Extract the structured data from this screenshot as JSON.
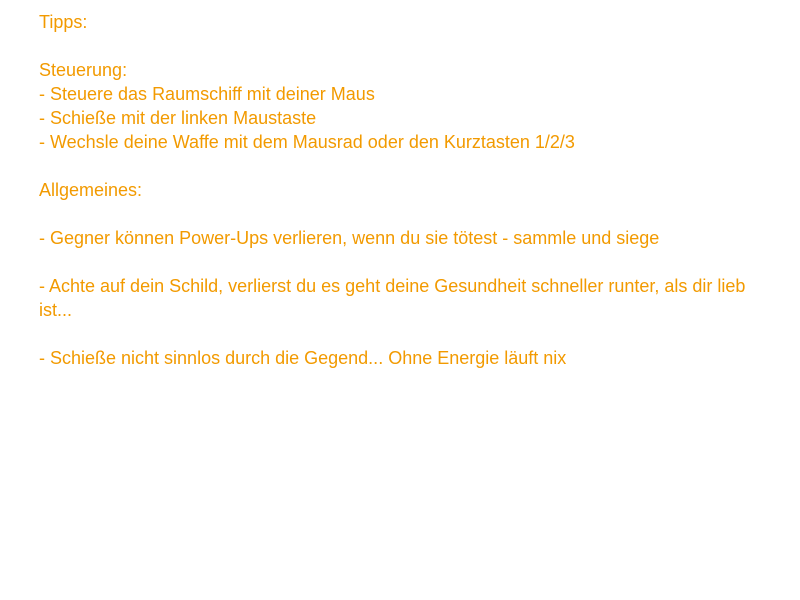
{
  "colors": {
    "text": "#f29a00",
    "background": "#ffffff"
  },
  "tips": {
    "heading": "Tipps:",
    "controls": {
      "heading": "Steuerung:",
      "items": [
        "- Steuere das Raumschiff mit deiner Maus",
        "- Schieße mit der linken Maustaste",
        "- Wechsle deine Waffe mit dem Mausrad oder den Kurztasten 1/2/3"
      ]
    },
    "general": {
      "heading": "Allgemeines:",
      "items": [
        "- Gegner können Power-Ups verlieren, wenn du sie tötest - sammle und siege",
        "- Achte auf dein Schild, verlierst du es geht deine Gesundheit schneller runter, als dir lieb ist...",
        "- Schieße nicht sinnlos durch die Gegend... Ohne Energie läuft nix"
      ]
    }
  }
}
